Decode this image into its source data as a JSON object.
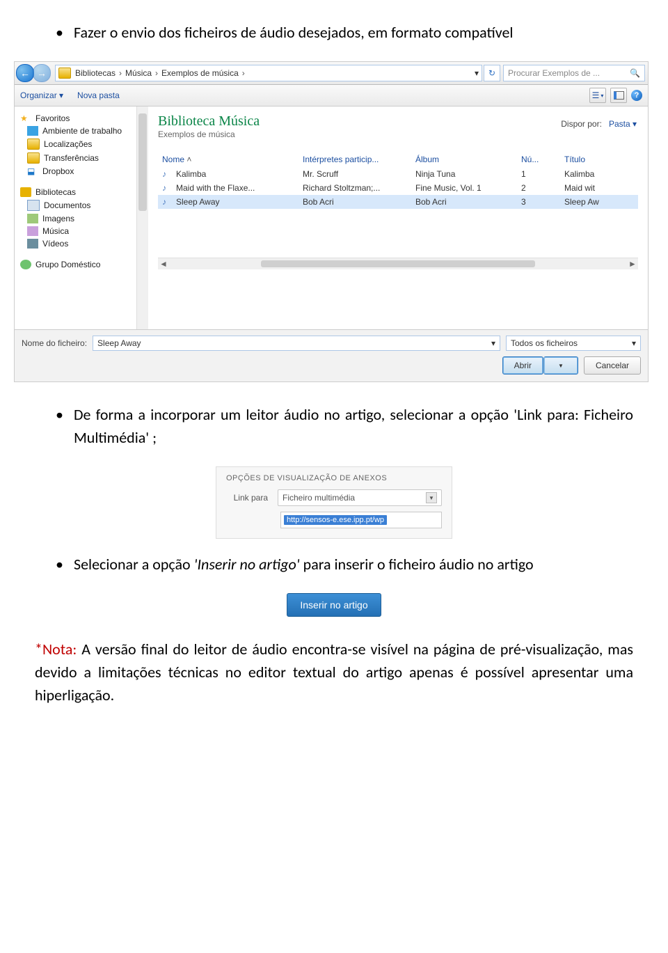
{
  "doc": {
    "bullet1": "Fazer o envio dos ficheiros de áudio desejados, em formato compatível",
    "bullet2_pre": "De forma a incorporar um leitor áudio no artigo, selecionar a opção 'Link para: Ficheiro Multimédia' ;",
    "bullet3_pre": "Selecionar a opção ",
    "bullet3_italic": "'Inserir no artigo'",
    "bullet3_post": " para inserir o ficheiro áudio no artigo",
    "note_prefix": "*Nota:",
    "note_body": " A versão final do leitor de áudio encontra-se visível na página de pré-visualização, mas devido a limitações técnicas no editor textual do artigo apenas é possível apresentar uma hiperligação."
  },
  "explorer": {
    "path": [
      "Bibliotecas",
      "Música",
      "Exemplos de música"
    ],
    "search_placeholder": "Procurar Exemplos de ...",
    "toolbar": {
      "organizar": "Organizar ▾",
      "nova_pasta": "Nova pasta"
    },
    "sidebar": {
      "fav_header": "Favoritos",
      "fav_items": [
        "Ambiente de trabalho",
        "Localizações",
        "Transferências",
        "Dropbox"
      ],
      "lib_header": "Bibliotecas",
      "lib_items": [
        "Documentos",
        "Imagens",
        "Música",
        "Vídeos"
      ],
      "homegroup": "Grupo Doméstico"
    },
    "main": {
      "title": "Biblioteca Música",
      "subtitle": "Exemplos de música",
      "dispor_label": "Dispor por:",
      "dispor_value": "Pasta ▾",
      "columns": [
        "Nome",
        "Intérpretes particip...",
        "Álbum",
        "Nú...",
        "Título"
      ],
      "rows": [
        {
          "nome": "Kalimba",
          "artist": "Mr. Scruff",
          "album": "Ninja Tuna",
          "num": "1",
          "title": "Kalimba"
        },
        {
          "nome": "Maid with the Flaxe...",
          "artist": "Richard Stoltzman;...",
          "album": "Fine Music, Vol. 1",
          "num": "2",
          "title": "Maid wit"
        },
        {
          "nome": "Sleep Away",
          "artist": "Bob Acri",
          "album": "Bob Acri",
          "num": "3",
          "title": "Sleep Aw"
        }
      ]
    },
    "bottom": {
      "filename_label": "Nome do ficheiro:",
      "filename_value": "Sleep Away",
      "filter": "Todos os ficheiros",
      "open": "Abrir",
      "cancel": "Cancelar"
    }
  },
  "options_panel": {
    "header": "OPÇÕES DE VISUALIZAÇÃO DE ANEXOS",
    "link_label": "Link para",
    "link_value": "Ficheiro multimédia",
    "url": "http://sensos-e.ese.ipp.pt/wp"
  },
  "buttons": {
    "inserir": "Inserir no artigo"
  }
}
